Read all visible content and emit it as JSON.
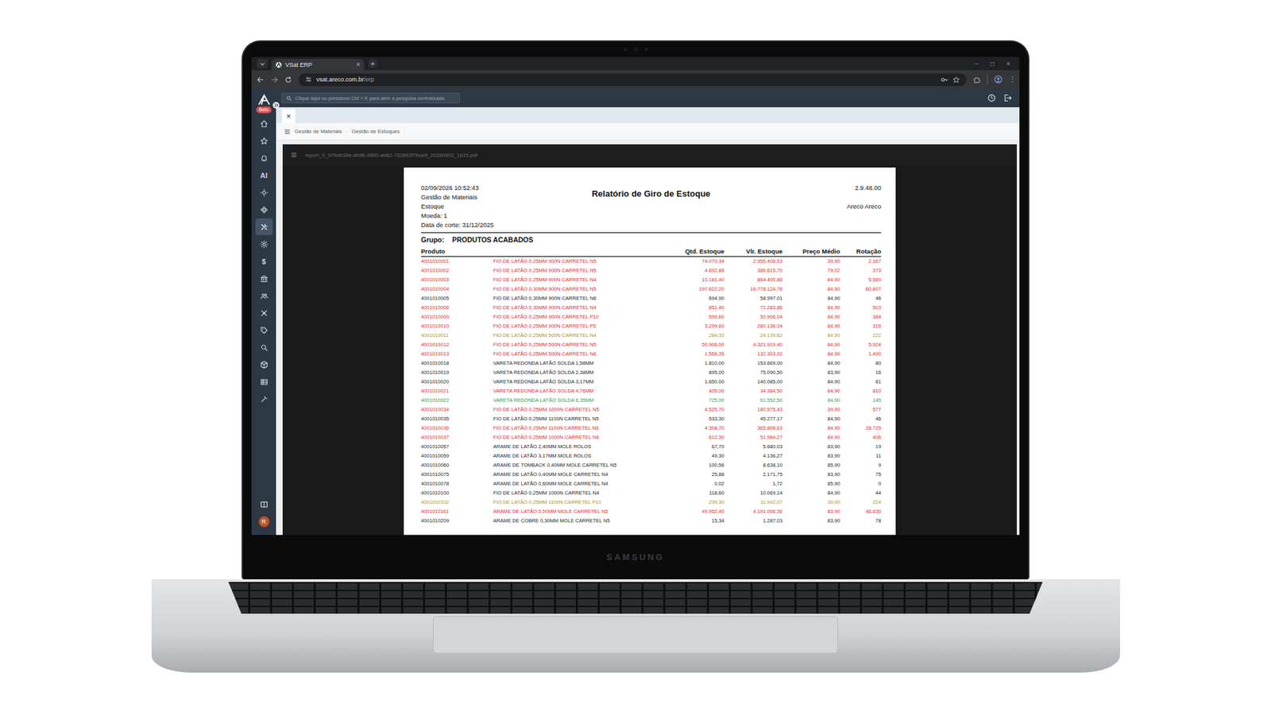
{
  "laptop": {
    "brand": "SAMSUNG"
  },
  "browser": {
    "tabs": [
      {
        "title": "VSat ERP",
        "close": "×",
        "selected": true
      }
    ],
    "new_tab": "+",
    "window_controls": [
      "−",
      "□",
      "×"
    ],
    "address": {
      "host": "vsat.areco.com.br",
      "path": "/erp"
    },
    "menu": "⋮"
  },
  "app": {
    "logo_badge": "Beta",
    "search": {
      "placeholder": "Clique aqui ou pressione Ctrl + K para abrir a pesquisa centralizada."
    },
    "sidebar": {
      "items": [
        {
          "selected": false
        },
        {
          "selected": false
        },
        {
          "selected": false
        },
        {
          "label": "AI",
          "selected": false
        },
        {
          "selected": false
        },
        {
          "selected": false
        },
        {
          "selected": true
        },
        {
          "selected": false
        },
        {
          "label": "$",
          "selected": false
        },
        {
          "selected": false
        },
        {
          "selected": false
        },
        {
          "selected": false
        },
        {
          "selected": false
        },
        {
          "selected": false
        },
        {
          "selected": false
        },
        {
          "selected": false
        },
        {
          "selected": false
        }
      ],
      "user_initial": "R"
    },
    "page_tabs": [
      {
        "close": "×",
        "selected": true
      }
    ],
    "breadcrumb": {
      "items": [
        "Gestão de Materiais",
        "Gestão de Estoques"
      ],
      "separator": "·"
    }
  },
  "viewer": {
    "file": "report_0_979db38e-db96-4500-ab82-732892f7bce9_20260902_1615.pdf"
  },
  "report": {
    "lines": [
      "02/09/2026 10:52:43",
      "Gestão de Materiais",
      "Estoque",
      "Moeda: 1",
      "Data de corte: 31/12/2025"
    ],
    "title": "Relatório de Giro de Estoque",
    "version": "2.9.48.00",
    "company": "Areco Areco",
    "group_label": "Grupo:",
    "group": "PRODUTOS ACABADOS",
    "columns": [
      "Produto",
      "Qtd. Estoque",
      "Vlr. Estoque",
      "Preço Médio",
      "Rotação"
    ],
    "rows": [
      {
        "code": "4001010001",
        "description": "FIO DE LATÃO 0,25MM 900N CARRETEL N5",
        "qty": "74.070,34",
        "value": "2.955.406,53",
        "avg_price": "39,90",
        "rotation": "2.167",
        "color": "#e3261f"
      },
      {
        "code": "4001010002",
        "description": "FIO DE LATÃO 0,25MM 900N CARRETEL N5",
        "qty": "4.892,88",
        "value": "386.615,70",
        "avg_price": "79,02",
        "rotation": "373",
        "color": "#e3261f"
      },
      {
        "code": "4001010003",
        "description": "FIO DE LATÃO 0,25MM 900N CARRETEL N4",
        "qty": "10.181,40",
        "value": "864.400,86",
        "avg_price": "84,90",
        "rotation": "5.589",
        "color": "#e3261f"
      },
      {
        "code": "4001010004",
        "description": "FIO DE LATÃO 0,30MM 900N CARRETEL N5",
        "qty": "197.622,20",
        "value": "16.778.124,78",
        "avg_price": "84,90",
        "rotation": "60.807",
        "color": "#e3261f"
      },
      {
        "code": "4001010005",
        "description": "FIO DE LATÃO 0,30MM 900N CARRETEL N6",
        "qty": "694,90",
        "value": "58.997,01",
        "avg_price": "84,90",
        "rotation": "46",
        "color": "#1a1a1a"
      },
      {
        "code": "4001010006",
        "description": "FIO DE LATÃO 0,30MM 900N CARRETEL N4",
        "qty": "851,40",
        "value": "72.283,86",
        "avg_price": "84,90",
        "rotation": "503",
        "color": "#e3261f"
      },
      {
        "code": "4001010009",
        "description": "FIO DE LATÃO 0,25MM 900N CARRETEL P10",
        "qty": "599,60",
        "value": "50.906,04",
        "avg_price": "84,90",
        "rotation": "384",
        "color": "#e3261f"
      },
      {
        "code": "4001010010",
        "description": "FIO DE LATÃO 0,25MM 900N CARRETEL P5",
        "qty": "3.299,60",
        "value": "280.136,04",
        "avg_price": "84,90",
        "rotation": "315",
        "color": "#e3261f"
      },
      {
        "code": "4001010011",
        "description": "FIO DE LATÃO 0,25MM 500N CARRETEL N4",
        "qty": "284,33",
        "value": "24.139,62",
        "avg_price": "84,90",
        "rotation": "222",
        "color": "#a8901c"
      },
      {
        "code": "4001010012",
        "description": "FIO DE LATÃO 0,25MM 500N CARRETEL N5",
        "qty": "50.906,00",
        "value": "4.321.919,40",
        "avg_price": "84,90",
        "rotation": "5.924",
        "color": "#e3261f"
      },
      {
        "code": "4001010013",
        "description": "FIO DE LATÃO 0,25MM 500N CARRETEL N6",
        "qty": "1.558,35",
        "value": "132.303,92",
        "avg_price": "84,90",
        "rotation": "1.400",
        "color": "#e3261f"
      },
      {
        "code": "4001010018",
        "description": "VARETA REDONDA LATÃO SOLDA 1,58MM",
        "qty": "1.810,00",
        "value": "153.669,00",
        "avg_price": "84,90",
        "rotation": "80",
        "color": "#1a1a1a"
      },
      {
        "code": "4001010019",
        "description": "VARETA REDONDA LATÃO SOLDA 2,38MM",
        "qty": "895,00",
        "value": "75.090,50",
        "avg_price": "83,90",
        "rotation": "16",
        "color": "#1a1a1a"
      },
      {
        "code": "4001010020",
        "description": "VARETA REDONDA LATÃO SOLDA 3,17MM",
        "qty": "1.650,00",
        "value": "140.085,00",
        "avg_price": "84,90",
        "rotation": "81",
        "color": "#1a1a1a"
      },
      {
        "code": "4001010021",
        "description": "VARETA REDONDA LATÃO SOLDA 4,76MM",
        "qty": "405,00",
        "value": "34.384,50",
        "avg_price": "84,90",
        "rotation": "810",
        "color": "#e3261f"
      },
      {
        "code": "4001010022",
        "description": "VARETA REDONDA LATÃO SOLDA 6,35MM",
        "qty": "725,00",
        "value": "61.552,50",
        "avg_price": "84,90",
        "rotation": "145",
        "color": "#2f9a3a"
      },
      {
        "code": "4001010034",
        "description": "FIO DE LATÃO 0,25MM 1000N CARRETEL N5",
        "qty": "4.525,70",
        "value": "180.575,43",
        "avg_price": "39,90",
        "rotation": "577",
        "color": "#e3261f"
      },
      {
        "code": "4001010035",
        "description": "FIO DE LATÃO 0,25MM 1100N CARRETEL N5",
        "qty": "533,30",
        "value": "45.277,17",
        "avg_price": "84,90",
        "rotation": "46",
        "color": "#1a1a1a"
      },
      {
        "code": "4001010036",
        "description": "FIO DE LATÃO 0,25MM 1100N CARRETEL N6",
        "qty": "4.308,70",
        "value": "365.808,63",
        "avg_price": "84,90",
        "rotation": "28.725",
        "color": "#e3261f"
      },
      {
        "code": "4001010037",
        "description": "FIO DE LATÃO 0,25MM 1000N CARRETEL N6",
        "qty": "612,30",
        "value": "51.984,27",
        "avg_price": "84,90",
        "rotation": "406",
        "color": "#e3261f"
      },
      {
        "code": "4001010057",
        "description": "ARAME DE LATÃO 2,40MM MOLE ROLOS",
        "qty": "67,70",
        "value": "5.680,03",
        "avg_price": "83,90",
        "rotation": "19",
        "color": "#1a1a1a"
      },
      {
        "code": "4001010059",
        "description": "ARAME DE LATÃO 3,17MM MOLE ROLOS",
        "qty": "49,30",
        "value": "4.136,27",
        "avg_price": "83,90",
        "rotation": "11",
        "color": "#1a1a1a"
      },
      {
        "code": "4001010060",
        "description": "ARAME DE TOMBACK 0,40MM MOLE CARRETEL N5",
        "qty": "100,56",
        "value": "8.638,10",
        "avg_price": "85,90",
        "rotation": "9",
        "color": "#1a1a1a"
      },
      {
        "code": "4001010075",
        "description": "ARAME DE LATÃO 0,40MM MOLE CARRETEL N4",
        "qty": "25,88",
        "value": "2.171,75",
        "avg_price": "83,90",
        "rotation": "75",
        "color": "#1a1a1a"
      },
      {
        "code": "4001010078",
        "description": "ARAME DE LATÃO 0,60MM MOLE CARRETEL N4",
        "qty": "0,02",
        "value": "1,72",
        "avg_price": "85,90",
        "rotation": "0",
        "color": "#1a1a1a"
      },
      {
        "code": "4001010100",
        "description": "FIO DE LATÃO 0,25MM 1000N CARRETEL N4",
        "qty": "118,60",
        "value": "10.069,14",
        "avg_price": "84,90",
        "rotation": "44",
        "color": "#1a1a1a"
      },
      {
        "code": "4001010102",
        "description": "FIO DE LATÃO 0,25MM 1100N CARRETEL P10",
        "qty": "299,30",
        "value": "11.942,07",
        "avg_price": "39,90",
        "rotation": "224",
        "color": "#a8901c"
      },
      {
        "code": "4001010161",
        "description": "ARAME DE LATÃO 0,50MM MOLE CARRETEL N5",
        "qty": "49.952,40",
        "value": "4.191.006,36",
        "avg_price": "83,90",
        "rotation": "46.830",
        "color": "#e3261f"
      },
      {
        "code": "4001010209",
        "description": "ARAME DE COBRE 0,30MM MOLE CARRETEL N5",
        "qty": "15,34",
        "value": "1.287,03",
        "avg_price": "83,90",
        "rotation": "78",
        "color": "#1a1a1a"
      }
    ]
  }
}
